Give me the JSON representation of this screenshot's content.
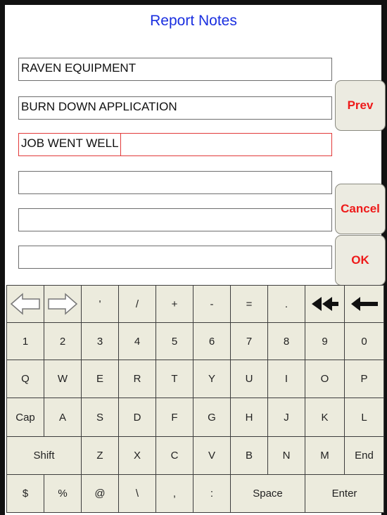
{
  "title": "Report Notes",
  "notes": [
    {
      "value": "RAVEN EQUIPMENT"
    },
    {
      "value": "BURN DOWN APPLICATION"
    },
    {
      "value": "JOB WENT WELL"
    },
    {
      "value": ""
    },
    {
      "value": ""
    },
    {
      "value": ""
    }
  ],
  "buttons": {
    "prev": "Prev",
    "cancel": "Cancel",
    "ok": "OK"
  },
  "accent_color": "#1a2fe0",
  "button_text_color": "#ee1a1a",
  "keyboard": {
    "row1": [
      "left-arrow-icon",
      "right-arrow-icon",
      "'",
      "/",
      "+",
      "-",
      "=",
      ".",
      "double-back-icon",
      "backspace-icon"
    ],
    "row1_symbols": {
      "k2": "'",
      "k3": "/",
      "k4": "+",
      "k5": "-",
      "k6": "=",
      "k7": "."
    },
    "row2": [
      "1",
      "2",
      "3",
      "4",
      "5",
      "6",
      "7",
      "8",
      "9",
      "0"
    ],
    "row3": [
      "Q",
      "W",
      "E",
      "R",
      "T",
      "Y",
      "U",
      "I",
      "O",
      "P"
    ],
    "row4": [
      "Cap",
      "A",
      "S",
      "D",
      "F",
      "G",
      "H",
      "J",
      "K",
      "L"
    ],
    "row5": [
      "Shift",
      "Z",
      "X",
      "C",
      "V",
      "B",
      "N",
      "M",
      "End"
    ],
    "row6": [
      "$",
      "%",
      "@",
      "\\",
      ",",
      ":",
      "Space",
      "Enter"
    ]
  }
}
